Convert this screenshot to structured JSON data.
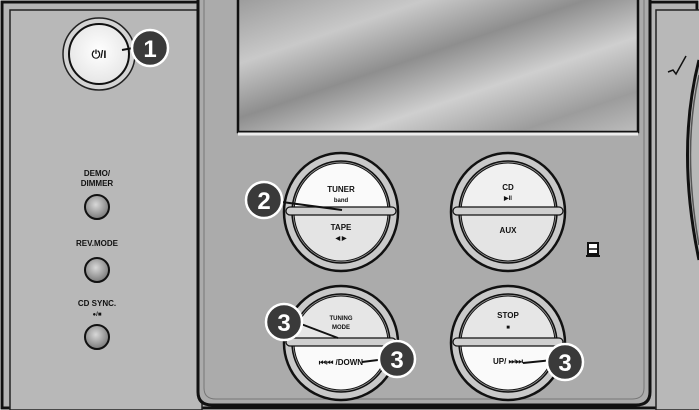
{
  "power_button": {
    "label": "⏻/I"
  },
  "left_buttons": [
    {
      "label_line1": "DEMO/",
      "label_line2": "DIMMER"
    },
    {
      "label_line1": "REV.MODE",
      "label_line2": ""
    },
    {
      "label_line1": "CD SYNC.",
      "label_line2": "●/■"
    }
  ],
  "center_buttons": {
    "tuner_tape": {
      "top_label": "TUNER",
      "top_sub": "band",
      "bottom_label": "TAPE",
      "bottom_sub": "◀ ▶"
    },
    "cd_aux": {
      "top_label": "CD",
      "top_sub": "▶II",
      "bottom_label": "AUX",
      "bottom_sub": ""
    },
    "tuning_down": {
      "top_label": "TUNING",
      "top_label2": "MODE",
      "bottom_label": "⏮⏮ /DOWN"
    },
    "stop_up": {
      "top_label": "STOP",
      "top_sub": "■",
      "bottom_label": "UP/ ⏭⏭"
    }
  },
  "callouts": [
    "1",
    "2",
    "3",
    "3",
    "3"
  ],
  "colors": {
    "panel": "#b3b3b3",
    "center_panel": "#a9a9a9",
    "callout_fill": "#3a3a3a",
    "outline": "#111111"
  }
}
